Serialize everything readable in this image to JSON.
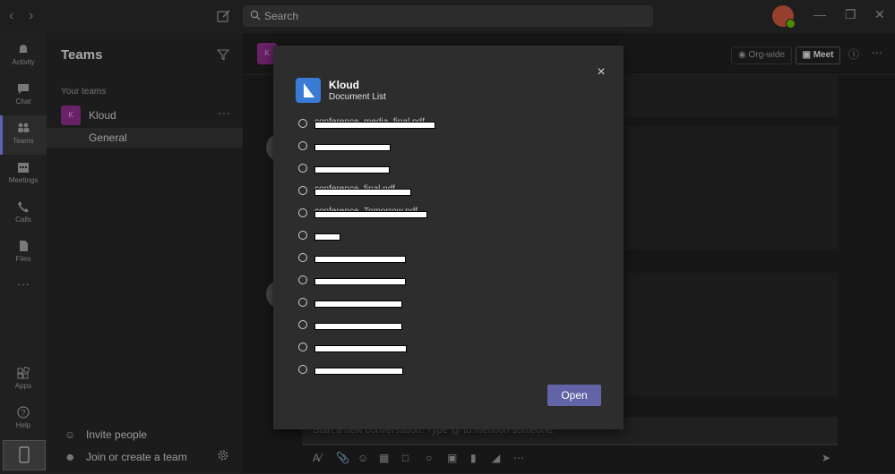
{
  "search": {
    "placeholder": "Search"
  },
  "rail": {
    "items": [
      {
        "label": "Activity",
        "icon": "bell-icon"
      },
      {
        "label": "Chat",
        "icon": "chat-icon"
      },
      {
        "label": "Teams",
        "icon": "teams-icon",
        "active": true
      },
      {
        "label": "Meetings",
        "icon": "calendar-icon"
      },
      {
        "label": "Calls",
        "icon": "phone-icon"
      },
      {
        "label": "Files",
        "icon": "file-icon"
      }
    ],
    "more": "···",
    "apps": "Apps",
    "help": "Help"
  },
  "panel": {
    "title": "Teams",
    "your_teams": "Your teams",
    "team": {
      "tile": "K",
      "name": "Kloud",
      "more": "···"
    },
    "channel": "General",
    "invite": "Invite people",
    "join": "Join or create a team"
  },
  "main": {
    "header_tile": "K",
    "orgwide": "Org-wide",
    "meet": "Meet",
    "composer_placeholder": "Start a new conversation. Type @ to mention someone."
  },
  "modal": {
    "app_name": "Kloud",
    "app_subtitle": "Document List",
    "close": "×",
    "documents": [
      {
        "name": "conference_media_final.pdf",
        "redact_width": 133
      },
      {
        "name": "",
        "redact_width": 83
      },
      {
        "name": "",
        "redact_width": 82
      },
      {
        "name": "conference_final.pdf",
        "redact_width": 106
      },
      {
        "name": "conference_Tomorrow.pdf",
        "redact_width": 124
      },
      {
        "name": "",
        "redact_width": 27
      },
      {
        "name": "",
        "redact_width": 100
      },
      {
        "name": "",
        "redact_width": 100
      },
      {
        "name": "",
        "redact_width": 96
      },
      {
        "name": "",
        "redact_width": 96
      },
      {
        "name": "",
        "redact_width": 101
      },
      {
        "name": "",
        "redact_width": 97
      }
    ],
    "open_label": "Open"
  },
  "colors": {
    "accent": "#6264a7",
    "team_tile": "#8e2c8b",
    "logo": "#3a7bd5"
  }
}
